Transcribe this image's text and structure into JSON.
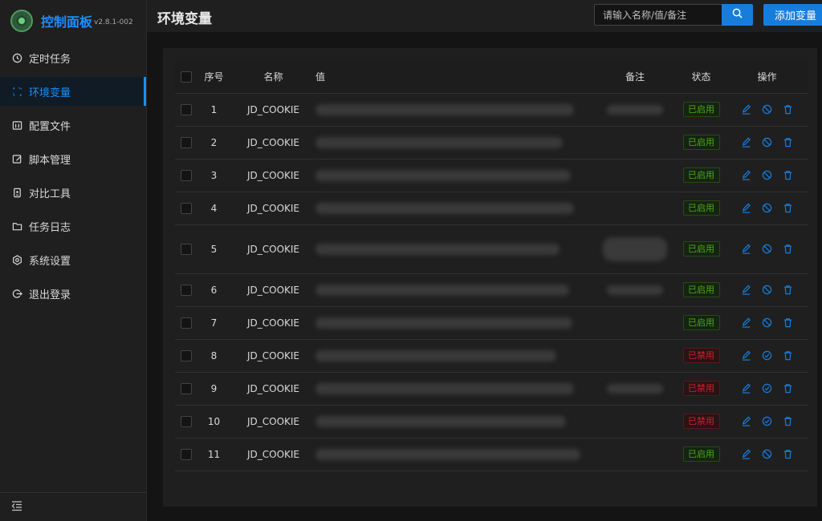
{
  "brand": {
    "title": "控制面板",
    "version": "v2.8.1-002"
  },
  "menu": [
    {
      "label": "定时任务",
      "icon": "clock-icon",
      "active": false
    },
    {
      "label": "环境变量",
      "icon": "variable-icon",
      "active": true
    },
    {
      "label": "配置文件",
      "icon": "config-file-icon",
      "active": false
    },
    {
      "label": "脚本管理",
      "icon": "edit-script-icon",
      "active": false
    },
    {
      "label": "对比工具",
      "icon": "diff-icon",
      "active": false
    },
    {
      "label": "任务日志",
      "icon": "folder-icon",
      "active": false
    },
    {
      "label": "系统设置",
      "icon": "settings-icon",
      "active": false
    },
    {
      "label": "退出登录",
      "icon": "logout-icon",
      "active": false
    }
  ],
  "header": {
    "title": "环境变量",
    "search_placeholder": "请输入名称/值/备注",
    "add_label": "添加变量"
  },
  "table": {
    "columns": {
      "index": "序号",
      "name": "名称",
      "value": "值",
      "note": "备注",
      "status": "状态",
      "ops": "操作"
    },
    "rows": [
      {
        "index": "1",
        "name": "JD_COOKIE",
        "status": "已启用",
        "enabled": true,
        "note": true,
        "tall": false
      },
      {
        "index": "2",
        "name": "JD_COOKIE",
        "status": "已启用",
        "enabled": true,
        "note": false,
        "tall": false
      },
      {
        "index": "3",
        "name": "JD_COOKIE",
        "status": "已启用",
        "enabled": true,
        "note": false,
        "tall": false
      },
      {
        "index": "4",
        "name": "JD_COOKIE",
        "status": "已启用",
        "enabled": true,
        "note": false,
        "tall": false
      },
      {
        "index": "5",
        "name": "JD_COOKIE",
        "status": "已启用",
        "enabled": true,
        "note": true,
        "tall": true
      },
      {
        "index": "6",
        "name": "JD_COOKIE",
        "status": "已启用",
        "enabled": true,
        "note": true,
        "tall": false
      },
      {
        "index": "7",
        "name": "JD_COOKIE",
        "status": "已启用",
        "enabled": true,
        "note": false,
        "tall": false
      },
      {
        "index": "8",
        "name": "JD_COOKIE",
        "status": "已禁用",
        "enabled": false,
        "note": false,
        "tall": false
      },
      {
        "index": "9",
        "name": "JD_COOKIE",
        "status": "已禁用",
        "enabled": false,
        "note": true,
        "tall": false
      },
      {
        "index": "10",
        "name": "JD_COOKIE",
        "status": "已禁用",
        "enabled": false,
        "note": false,
        "tall": false
      },
      {
        "index": "11",
        "name": "JD_COOKIE",
        "status": "已启用",
        "enabled": true,
        "note": false,
        "tall": false
      }
    ]
  },
  "colors": {
    "accent": "#177ddc",
    "enabled": "#49aa19",
    "disabled": "#d32029"
  }
}
